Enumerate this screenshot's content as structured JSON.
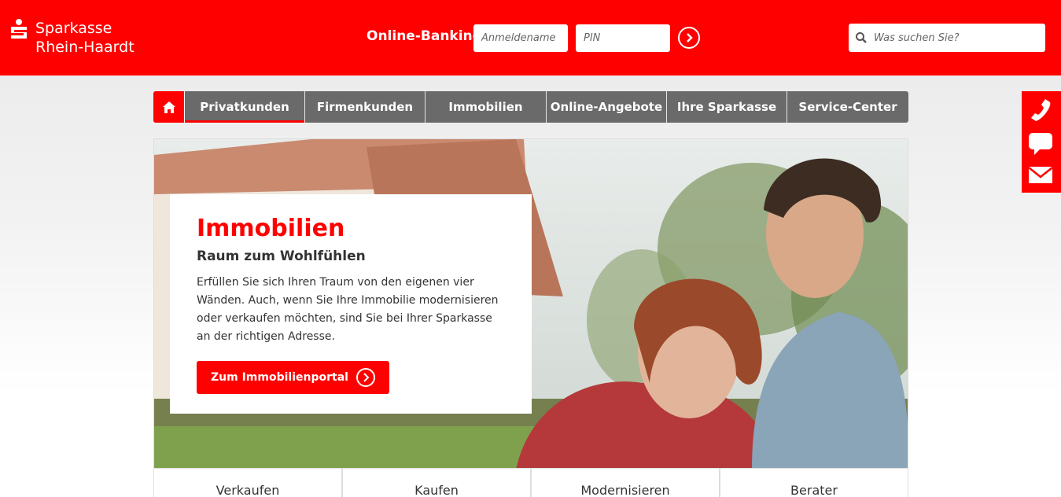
{
  "brand": {
    "line1": "Sparkasse",
    "line2": "Rhein-Haardt",
    "color": "#ff0000"
  },
  "login": {
    "label": "Online-Banking",
    "username_placeholder": "Anmeldename",
    "pin_placeholder": "PIN",
    "submit_icon": "chevron-right-circle-icon"
  },
  "search": {
    "placeholder": "Was suchen Sie?",
    "icon": "search-icon"
  },
  "nav": {
    "home_icon": "home-icon",
    "items": [
      {
        "label": "Privatkunden",
        "active": true
      },
      {
        "label": "Firmenkunden",
        "active": false
      },
      {
        "label": "Immobilien",
        "active": false
      },
      {
        "label": "Online-Angebote",
        "active": false
      },
      {
        "label": "Ihre Sparkasse",
        "active": false
      },
      {
        "label": "Service-Center",
        "active": false
      }
    ]
  },
  "contact": {
    "icons": [
      "phone-icon",
      "chat-icon",
      "mail-icon"
    ]
  },
  "hero": {
    "title": "Immobilien",
    "subtitle": "Raum zum Wohlfühlen",
    "text": "Erfüllen Sie sich Ihren Traum von den eigenen vier Wänden. Auch, wenn Sie Ihre Immobilie modernisieren oder verkaufen möchten, sind Sie bei Ihrer Sparkasse an der richtigen Adresse.",
    "cta_label": "Zum Immobilienportal"
  },
  "tiles": [
    {
      "label": "Verkaufen"
    },
    {
      "label": "Kaufen"
    },
    {
      "label": "Modernisieren"
    },
    {
      "label": "Berater"
    }
  ]
}
